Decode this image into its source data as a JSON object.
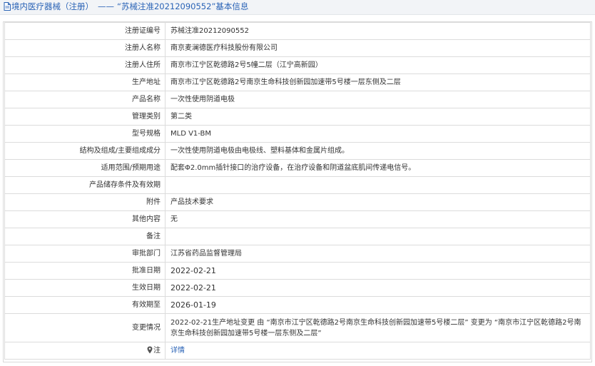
{
  "header": {
    "category": "境内医疗器械（注册）",
    "separator": "——",
    "title": "“苏械注准20212090552”基本信息"
  },
  "rows": [
    {
      "label": "注册证编号",
      "value": "苏械注准20212090552"
    },
    {
      "label": "注册人名称",
      "value": "南京麦澜德医疗科技股份有限公司"
    },
    {
      "label": "注册人住所",
      "value": "南京市江宁区乾德路2号5幢二层（江宁高新园）"
    },
    {
      "label": "生产地址",
      "value": "南京市江宁区乾德路2号南京生命科技创新园加速带5号楼一层东侧及二层"
    },
    {
      "label": "产品名称",
      "value": "一次性使用阴道电极"
    },
    {
      "label": "管理类别",
      "value": "第二类"
    },
    {
      "label": "型号规格",
      "value": "MLD V1-BM"
    },
    {
      "label": "结构及组成/主要组成成分",
      "value": "一次性使用阴道电极由电极线、塑料基体和金属片组成。"
    },
    {
      "label": "适用范围/预期用途",
      "value": "配套Φ2.0mm插针接口的治疗设备，在治疗设备和阴道盆底肌间传递电信号。"
    },
    {
      "label": "产品储存条件及有效期",
      "value": ""
    },
    {
      "label": "附件",
      "value": "产品技术要求"
    },
    {
      "label": "其他内容",
      "value": "无"
    },
    {
      "label": "备注",
      "value": ""
    },
    {
      "label": "审批部门",
      "value": "江苏省药品监督管理局"
    },
    {
      "label": "批准日期",
      "value": "2022-02-21"
    },
    {
      "label": "生效日期",
      "value": "2022-02-21"
    },
    {
      "label": "有效期至",
      "value": "2026-01-19"
    },
    {
      "label": "变更情况",
      "value": "2022-02-21生产地址变更 由 “南京市江宁区乾德路2号南京生命科技创新园加速带5号楼二层” 变更为 “南京市江宁区乾德路2号南京生命科技创新园加速带5号楼一层东侧及二层”"
    }
  ],
  "note": {
    "label": "注",
    "link": "详情"
  },
  "colors": {
    "link": "#2a63b6",
    "header_bg": "#f2f4f7",
    "border": "#dcdcdc"
  },
  "icons": {
    "header": "document-icon",
    "note": "pin-icon"
  }
}
